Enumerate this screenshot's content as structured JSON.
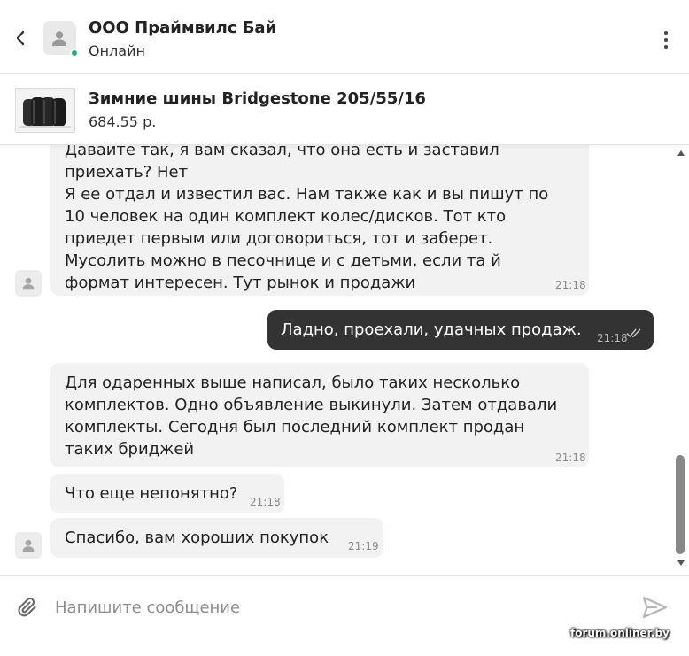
{
  "header": {
    "seller_name": "ООО Праймвилс Бай",
    "status": "Онлайн"
  },
  "product": {
    "title": "Зимние шины Bridgestone 205/55/16",
    "price": "684.55 р."
  },
  "messages": [
    {
      "direction": "in",
      "lines": [
        "Давайте так, я вам сказал, что она есть и заставил",
        "приехать? Нет",
        "Я ее отдал и известил вас. Нам также как и вы пишут по",
        "10 человек на один комплект колес/дисков. Тот кто",
        "приедет первым или договориться, тот и заберет.",
        "Мусолить можно в песочнице и с детьми, если та й",
        "формат интересен. Тут рынок и продажи"
      ],
      "time": "21:18"
    },
    {
      "direction": "out",
      "lines": [
        "Ладно, проехали, удачных продаж."
      ],
      "time": "21:18",
      "read_status": "double-check-icon"
    },
    {
      "direction": "in",
      "lines": [
        "Для одаренных выше написал, было таких несколько",
        "комплектов. Одно объявление выкинули. Затем отдавали",
        "комплекты. Сегодня был последний комплект продан",
        "таких бриджей"
      ],
      "time": "21:18"
    },
    {
      "direction": "in",
      "lines": [
        "Что еще непонятно?"
      ],
      "time": "21:18"
    },
    {
      "direction": "in",
      "lines": [
        "Спасибо, вам хороших покупок"
      ],
      "time": "21:19"
    }
  ],
  "composer": {
    "placeholder": "Напишите сообщение",
    "value": ""
  },
  "watermark": "forum.onliner.by",
  "icons": {
    "back": "chevron-left-icon",
    "more": "more-vertical-icon",
    "attach": "paperclip-icon",
    "send": "send-icon",
    "avatar": "user-icon"
  },
  "colors": {
    "online": "#17b964",
    "incoming_bubble": "#f2f2f2",
    "outgoing_bubble": "#333333",
    "send_icon": "#b5b5b5"
  }
}
